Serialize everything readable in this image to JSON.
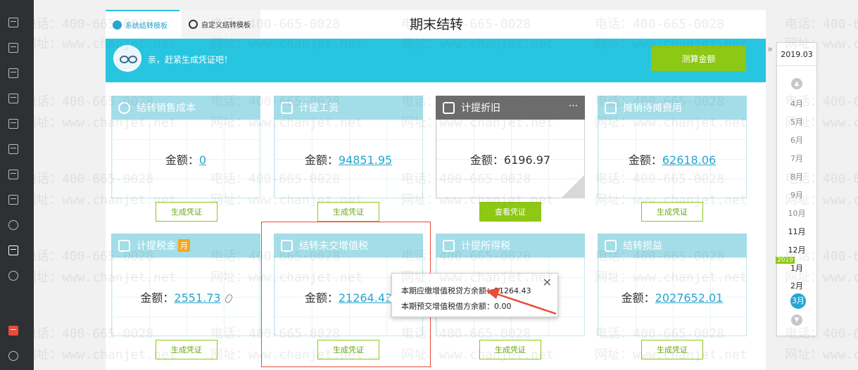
{
  "header": {
    "title": "期末结转",
    "tabs": [
      {
        "label": "系统结转模板",
        "active": true
      },
      {
        "label": "自定义结转模板",
        "active": false
      }
    ]
  },
  "banner": {
    "message": "亲，赶紧生成凭证吧！",
    "calc_button": "测算金额"
  },
  "amount_prefix": "金额：",
  "cards": [
    {
      "title": "结转销售成本",
      "amount": "0",
      "button": "生成凭证",
      "linked": true
    },
    {
      "title": "计提工资",
      "amount": "94851.95",
      "button": "生成凭证",
      "linked": true
    },
    {
      "title": "计提折旧",
      "amount": "6196.97",
      "button": "查看凭证",
      "linked": false,
      "more": "···"
    },
    {
      "title": "摊销待摊费用",
      "amount": "62618.06",
      "button": "生成凭证",
      "linked": true
    },
    {
      "title": "计提税金",
      "badge": "月",
      "amount": "2551.73",
      "button": "生成凭证",
      "linked": true
    },
    {
      "title": "结转未交增值税",
      "amount": "21264.43",
      "button": "生成凭证",
      "linked": true
    },
    {
      "title": "计提所得税",
      "amount": "",
      "button": "生成凭证",
      "linked": false
    },
    {
      "title": "结转损益",
      "amount": "2027652.01",
      "button": "生成凭证",
      "linked": true
    }
  ],
  "tooltip": {
    "line1": "本期应缴增值税贷方余额：21264.43",
    "line2": "本期预交增值税借方余额：0.00",
    "close": "✕"
  },
  "timeline": {
    "period": "2019.03",
    "collapse": "»",
    "months": [
      "4月",
      "5月",
      "6月",
      "7月",
      "8月",
      "9月",
      "10月",
      "11月",
      "12月",
      "1月",
      "2月"
    ],
    "year_badge": "2019",
    "current": "3月"
  },
  "watermark": {
    "phone": "电话：400-665-0028",
    "site": "网址：www.chanjet.net"
  },
  "colors": {
    "accent": "#27c5e0",
    "card_header": "#a3dde8",
    "green": "#8dc814",
    "highlight_red": "#e74c3c",
    "rail": "#2e3034"
  }
}
